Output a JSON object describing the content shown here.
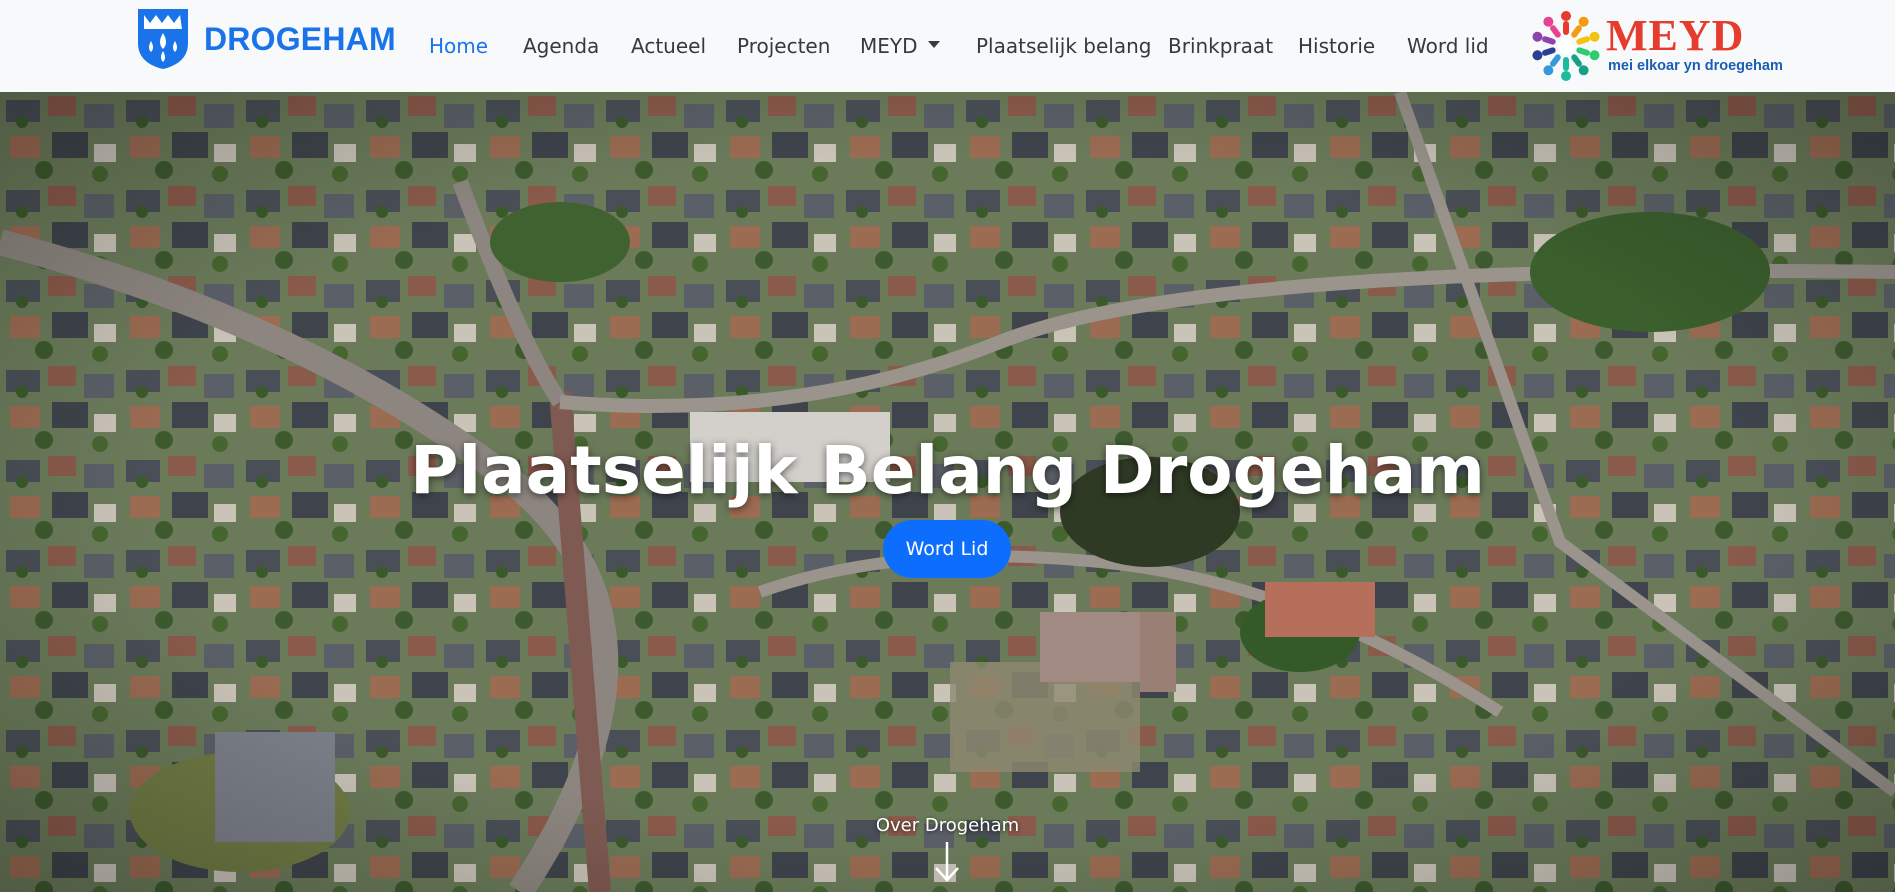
{
  "brand": {
    "name": "DROGEHAM",
    "crest_icon": "drogeham-crest-icon"
  },
  "nav": {
    "items": [
      {
        "label": "Home",
        "active": true
      },
      {
        "label": "Agenda"
      },
      {
        "label": "Actueel"
      },
      {
        "label": "Projecten"
      },
      {
        "label": "MEYD",
        "dropdown": true
      },
      {
        "label": "Plaatselijk belang"
      },
      {
        "label": "Brinkpraat"
      },
      {
        "label": "Historie"
      },
      {
        "label": "Word lid"
      }
    ]
  },
  "meyd_logo": {
    "title": "MEYD",
    "subtitle": "mei elkoar yn droegeham"
  },
  "hero": {
    "title": "Plaatselijk Belang Drogeham",
    "button_label": "Word Lid",
    "scroll_label": "Over Drogeham",
    "scroll_icon": "arrow-down-icon"
  },
  "colors": {
    "accent": "#0d6efd",
    "brand_blue": "#1a73e8",
    "meyd_red": "#e53c2e"
  }
}
